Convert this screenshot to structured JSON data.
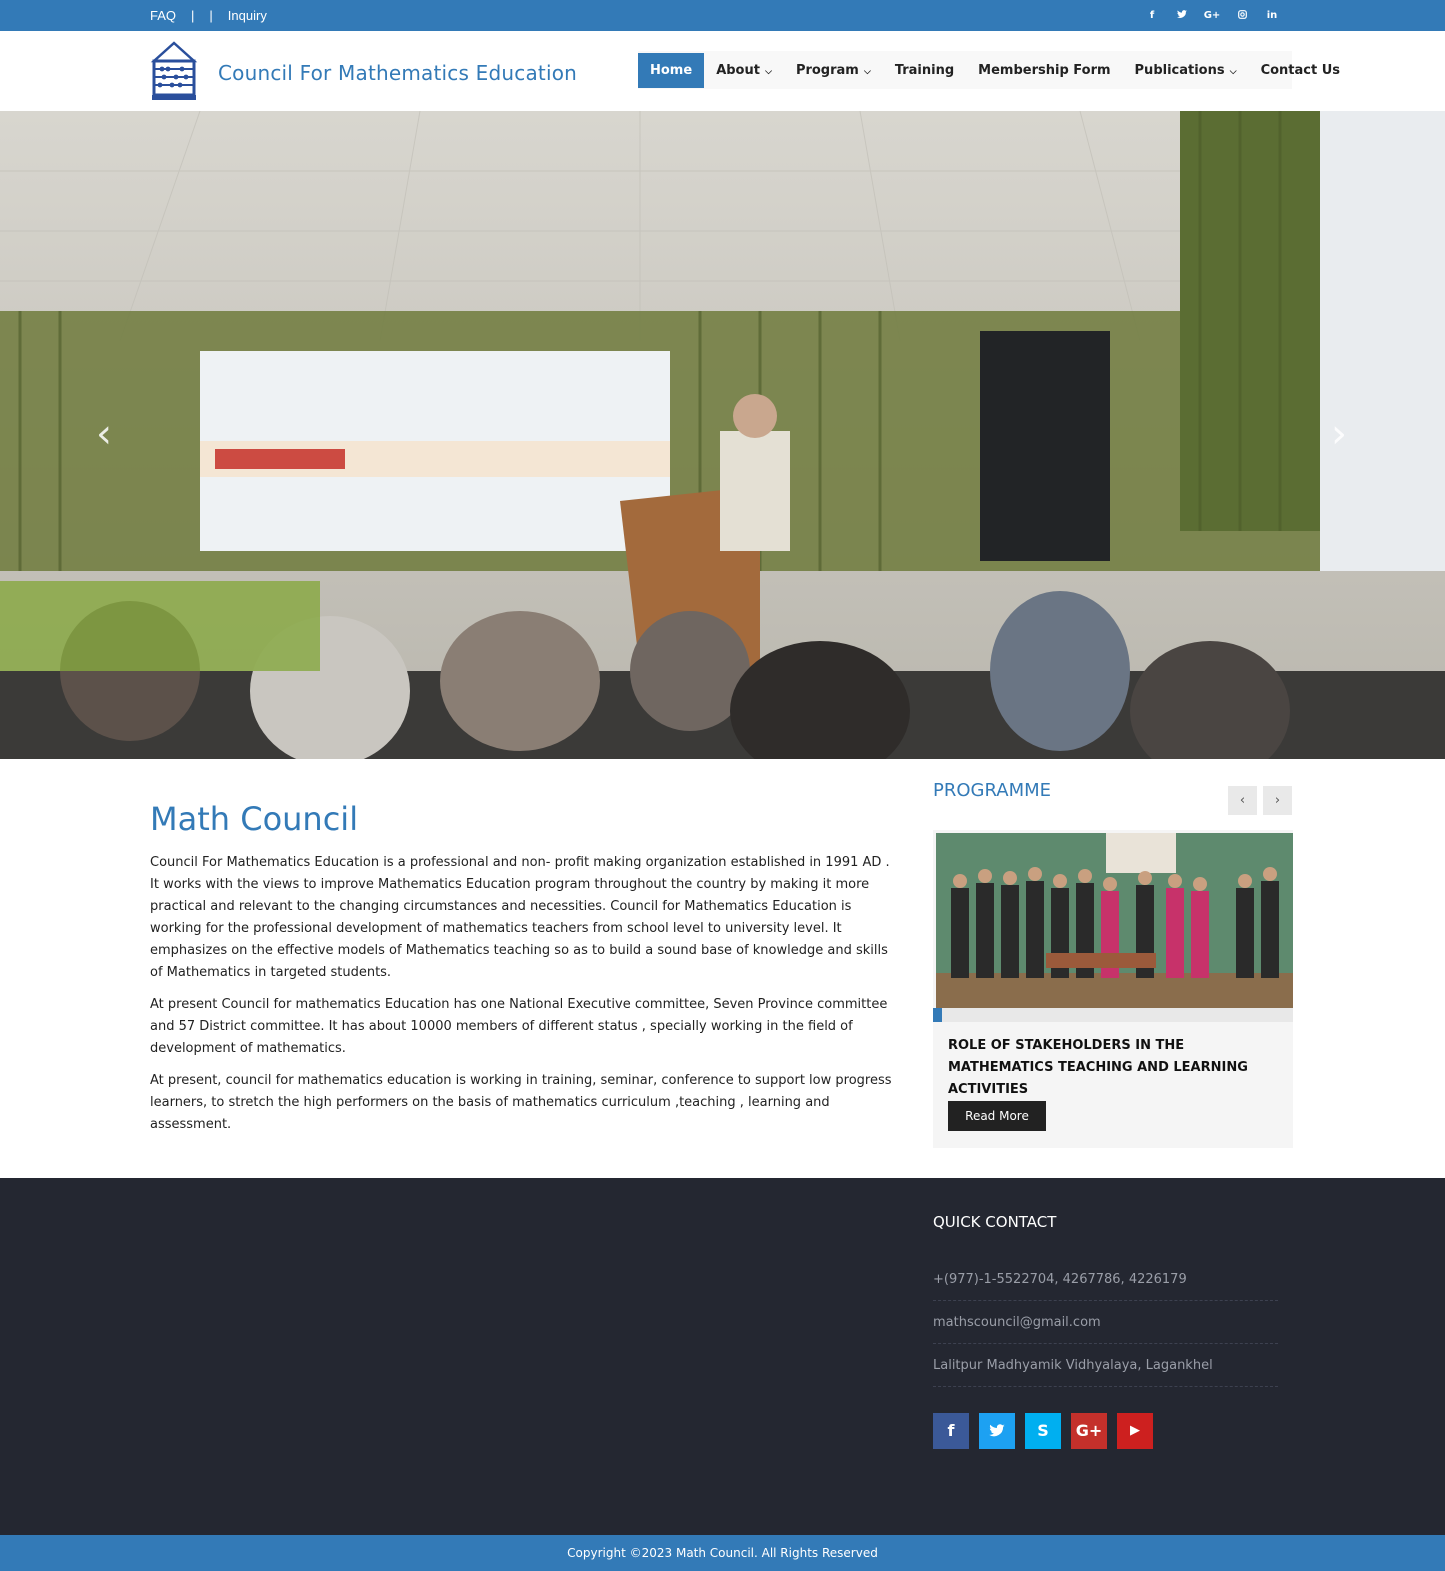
{
  "topbar": {
    "faq": "FAQ",
    "separator": "|",
    "inquiry": "Inquiry",
    "social_icons": [
      "facebook-icon",
      "twitter-icon",
      "google-plus-icon",
      "instagram-icon",
      "linkedin-icon"
    ]
  },
  "header": {
    "site_title": "Council For Mathematics Education",
    "nav": [
      {
        "label": "Home",
        "active": true
      },
      {
        "label": "About",
        "dropdown": true
      },
      {
        "label": "Program",
        "dropdown": true
      },
      {
        "label": "Training"
      },
      {
        "label": "Membership Form"
      },
      {
        "label": "Publications",
        "dropdown": true
      },
      {
        "label": "Contact Us"
      }
    ],
    "caret": "⌄"
  },
  "hero": {
    "prev": "‹",
    "next": "›"
  },
  "intro": {
    "title": "Math Council",
    "paragraphs": [
      "Council For Mathematics Education is a professional and non- profit making organization established in 1991 AD . It works with the views to improve Mathematics Education program throughout the country by making it more practical and relevant to the changing circumstances and necessities. Council for Mathematics Education is working for the professional development of mathematics teachers from school level to university level. It emphasizes on the effective models of Mathematics teaching so as to build a sound base of knowledge and skills of Mathematics in targeted students.",
      "At present Council for mathematics Education has one National Executive committee, Seven Province committee and 57 District committee. It has about 10000 members of different status , specially working in the field of development of mathematics.",
      "At present, council for mathematics education is working in training, seminar, conference to support low progress learners, to stretch the high performers on the basis of mathematics curriculum ,teaching , learning and assessment."
    ]
  },
  "programme": {
    "heading": "PROGRAMME",
    "prev": "‹",
    "next": "›",
    "card_title": "ROLE OF STAKEHOLDERS IN THE MATHEMATICS TEACHING AND LEARNING ACTIVITIES",
    "read_more": "Read More"
  },
  "footer": {
    "quick_contact": "QUICK CONTACT",
    "phone": "+(977)-1-5522704, 4267786, 4226179",
    "email": "mathscouncil@gmail.com",
    "address": "Lalitpur Madhyamik Vidhyalaya, Lagankhel",
    "social": [
      {
        "icon": "facebook-icon",
        "glyph": "f",
        "color": "#3b5998"
      },
      {
        "icon": "twitter-icon",
        "glyph": "t",
        "color": "#1da1f2"
      },
      {
        "icon": "skype-icon",
        "glyph": "S",
        "color": "#00aff0"
      },
      {
        "icon": "google-plus-icon",
        "glyph": "G+",
        "color": "#c4302b"
      },
      {
        "icon": "youtube-icon",
        "glyph": "▶",
        "color": "#cd201f"
      }
    ],
    "copyright": "Copyright ©2023 Math Council. All Rights Reserved"
  }
}
